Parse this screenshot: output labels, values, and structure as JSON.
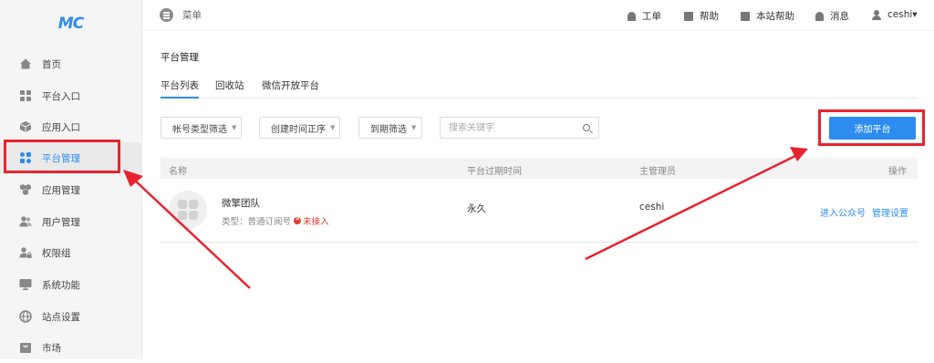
{
  "logo": {
    "text": "MC"
  },
  "sidebar": {
    "items": [
      {
        "label": "首页",
        "icon": "home-icon"
      },
      {
        "label": "平台入口",
        "icon": "grid-icon"
      },
      {
        "label": "应用入口",
        "icon": "cube-icon"
      },
      {
        "label": "平台管理",
        "icon": "apps-icon",
        "active": true
      },
      {
        "label": "应用管理",
        "icon": "cubes-icon"
      },
      {
        "label": "用户管理",
        "icon": "users-icon"
      },
      {
        "label": "权限组",
        "icon": "user-lock-icon"
      },
      {
        "label": "系统功能",
        "icon": "monitor-icon"
      },
      {
        "label": "站点设置",
        "icon": "globe-icon"
      },
      {
        "label": "市场",
        "icon": "bag-icon"
      }
    ]
  },
  "topbar": {
    "menu_label": "菜单",
    "links": [
      {
        "label": "工单",
        "icon": "bell-icon"
      },
      {
        "label": "帮助",
        "icon": "bag-icon"
      },
      {
        "label": "本站帮助",
        "icon": "bag-icon"
      },
      {
        "label": "消息",
        "icon": "bell-icon"
      },
      {
        "label": "ceshi▾",
        "icon": "user-icon"
      }
    ]
  },
  "main": {
    "title": "平台管理",
    "tabs": [
      {
        "label": "平台列表",
        "active": true
      },
      {
        "label": "回收站"
      },
      {
        "label": "微信开放平台"
      }
    ],
    "filters": {
      "account_type": "帐号类型筛选",
      "create_time": "创建时间正序",
      "expire": "到期筛选"
    },
    "search": {
      "placeholder": "搜索关键字",
      "value": ""
    },
    "add_button": "添加平台",
    "table": {
      "headers": [
        "名称",
        "平台过期时间",
        "主管理员",
        "操作"
      ],
      "rows": [
        {
          "name": "微擎团队",
          "type_label": "类型：普通订阅号",
          "status": "未接入",
          "expire": "永久",
          "admin": "ceshi",
          "actions": [
            "进入公众号",
            "管理设置"
          ]
        }
      ]
    }
  },
  "colors": {
    "accent": "#2d8cf0",
    "annotation": "#e8232f",
    "error": "#e03a2e"
  }
}
